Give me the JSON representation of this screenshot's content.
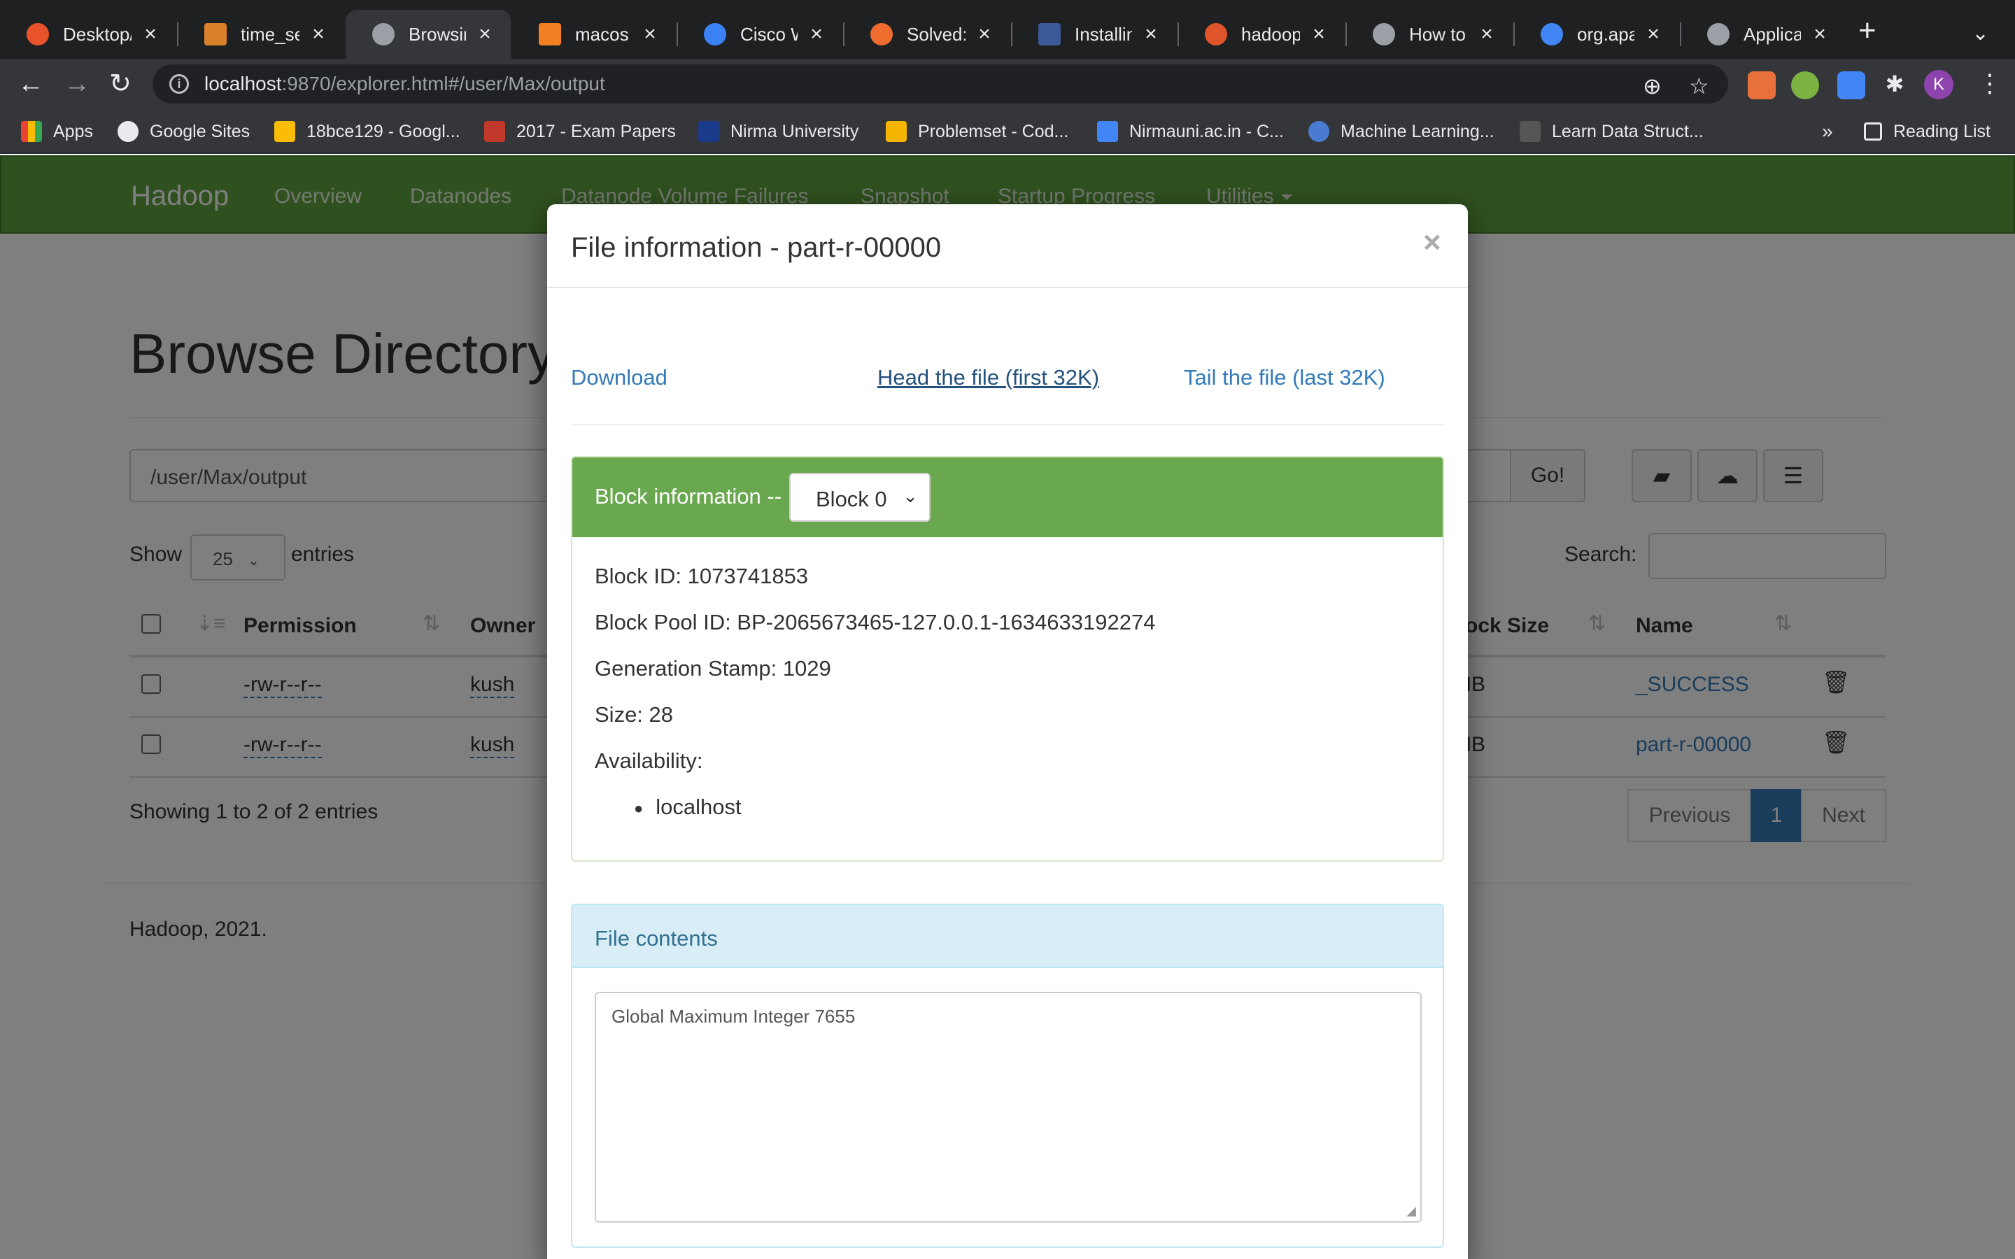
{
  "browser": {
    "tabs": [
      {
        "title": "Desktop/",
        "color": "#e8532b"
      },
      {
        "title": "time_seri",
        "color": "#d9822b"
      },
      {
        "title": "Browsing",
        "color": "#9aa0a6"
      },
      {
        "title": "macos - F",
        "color": "#f48024"
      },
      {
        "title": "Cisco We",
        "color": "#3b82f6"
      },
      {
        "title": "Solved: G",
        "color": "#ef6c2e"
      },
      {
        "title": "Installing",
        "color": "#3b5998"
      },
      {
        "title": "hadoop -",
        "color": "#e0542b"
      },
      {
        "title": "How to In",
        "color": "#9aa0a6"
      },
      {
        "title": "org.apach",
        "color": "#4285f4"
      },
      {
        "title": "Applicatio",
        "color": "#9aa0a6"
      }
    ],
    "url_host": "localhost",
    "url_rest": ":9870/explorer.html#/user/Max/output",
    "avatar_letter": "K",
    "bookmarks": [
      {
        "label": "Apps",
        "color": "#ea4335"
      },
      {
        "label": "Google Sites",
        "color": "#e8eaed"
      },
      {
        "label": "18bce129 - Googl...",
        "color": "#fbbc04"
      },
      {
        "label": "2017 - Exam Papers",
        "color": "#c0392b"
      },
      {
        "label": "Nirma University",
        "color": "#1a3a8a"
      },
      {
        "label": "Problemset - Cod...",
        "color": "#f5b400"
      },
      {
        "label": "Nirmauni.ac.in - C...",
        "color": "#4285f4"
      },
      {
        "label": "Machine Learning...",
        "color": "#4a7bd0"
      },
      {
        "label": "Learn Data Struct...",
        "color": "#555555"
      }
    ],
    "more_bookmarks": "»",
    "reading_list": "Reading List"
  },
  "navbar": {
    "brand": "Hadoop",
    "links": [
      "Overview",
      "Datanodes",
      "Datanode Volume Failures",
      "Snapshot",
      "Startup Progress",
      "Utilities"
    ]
  },
  "main": {
    "heading": "Browse Directory",
    "path": "/user/Max/output",
    "go_label": "Go!",
    "show_label": "Show",
    "page_length": "25",
    "entries_label": "entries",
    "search_label": "Search:",
    "columns": {
      "permission": "Permission",
      "owner": "Owner",
      "block_size": "Block Size",
      "name": "Name"
    },
    "rows": [
      {
        "permission": "-rw-r--r--",
        "owner": "kush",
        "block_size": "MB",
        "name": "_SUCCESS"
      },
      {
        "permission": "-rw-r--r--",
        "owner": "kush",
        "block_size": "MB",
        "name": "part-r-00000"
      }
    ],
    "showing": "Showing 1 to 2 of 2 entries",
    "pager": {
      "previous": "Previous",
      "current": "1",
      "next": "Next"
    },
    "footer": "Hadoop, 2021."
  },
  "modal": {
    "title": "File information - part-r-00000",
    "close": "×",
    "download": "Download",
    "head": "Head the file (first 32K)",
    "tail": "Tail the file (last 32K)",
    "block_title": "Block information --",
    "block_selected": "Block 0",
    "block_id": "Block ID: 1073741853",
    "block_pool": "Block Pool ID: BP-2065673465-127.0.0.1-1634633192274",
    "generation": "Generation Stamp: 1029",
    "size": "Size: 28",
    "availability": "Availability:",
    "hosts": [
      "localhost"
    ],
    "contents_title": "File contents",
    "contents": "Global Maximum Integer 7655"
  },
  "colors": {
    "navbar": "#5fa33e",
    "panel_green": "#6aa84f",
    "link": "#337ab7",
    "panel_blue": "#d9edf7"
  }
}
